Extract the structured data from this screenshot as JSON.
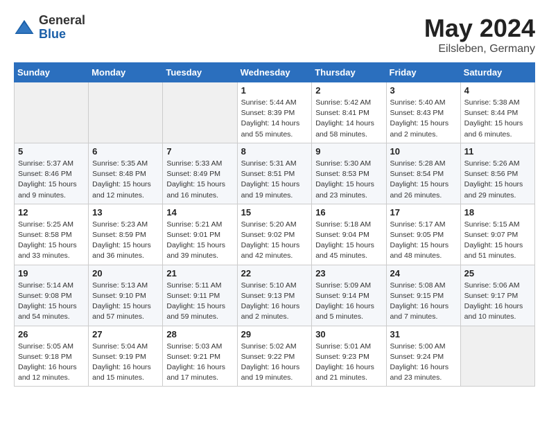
{
  "header": {
    "logo_general": "General",
    "logo_blue": "Blue",
    "title": "May 2024",
    "location": "Eilsleben, Germany"
  },
  "weekdays": [
    "Sunday",
    "Monday",
    "Tuesday",
    "Wednesday",
    "Thursday",
    "Friday",
    "Saturday"
  ],
  "weeks": [
    [
      {
        "day": "",
        "info": ""
      },
      {
        "day": "",
        "info": ""
      },
      {
        "day": "",
        "info": ""
      },
      {
        "day": "1",
        "info": "Sunrise: 5:44 AM\nSunset: 8:39 PM\nDaylight: 14 hours\nand 55 minutes."
      },
      {
        "day": "2",
        "info": "Sunrise: 5:42 AM\nSunset: 8:41 PM\nDaylight: 14 hours\nand 58 minutes."
      },
      {
        "day": "3",
        "info": "Sunrise: 5:40 AM\nSunset: 8:43 PM\nDaylight: 15 hours\nand 2 minutes."
      },
      {
        "day": "4",
        "info": "Sunrise: 5:38 AM\nSunset: 8:44 PM\nDaylight: 15 hours\nand 6 minutes."
      }
    ],
    [
      {
        "day": "5",
        "info": "Sunrise: 5:37 AM\nSunset: 8:46 PM\nDaylight: 15 hours\nand 9 minutes."
      },
      {
        "day": "6",
        "info": "Sunrise: 5:35 AM\nSunset: 8:48 PM\nDaylight: 15 hours\nand 12 minutes."
      },
      {
        "day": "7",
        "info": "Sunrise: 5:33 AM\nSunset: 8:49 PM\nDaylight: 15 hours\nand 16 minutes."
      },
      {
        "day": "8",
        "info": "Sunrise: 5:31 AM\nSunset: 8:51 PM\nDaylight: 15 hours\nand 19 minutes."
      },
      {
        "day": "9",
        "info": "Sunrise: 5:30 AM\nSunset: 8:53 PM\nDaylight: 15 hours\nand 23 minutes."
      },
      {
        "day": "10",
        "info": "Sunrise: 5:28 AM\nSunset: 8:54 PM\nDaylight: 15 hours\nand 26 minutes."
      },
      {
        "day": "11",
        "info": "Sunrise: 5:26 AM\nSunset: 8:56 PM\nDaylight: 15 hours\nand 29 minutes."
      }
    ],
    [
      {
        "day": "12",
        "info": "Sunrise: 5:25 AM\nSunset: 8:58 PM\nDaylight: 15 hours\nand 33 minutes."
      },
      {
        "day": "13",
        "info": "Sunrise: 5:23 AM\nSunset: 8:59 PM\nDaylight: 15 hours\nand 36 minutes."
      },
      {
        "day": "14",
        "info": "Sunrise: 5:21 AM\nSunset: 9:01 PM\nDaylight: 15 hours\nand 39 minutes."
      },
      {
        "day": "15",
        "info": "Sunrise: 5:20 AM\nSunset: 9:02 PM\nDaylight: 15 hours\nand 42 minutes."
      },
      {
        "day": "16",
        "info": "Sunrise: 5:18 AM\nSunset: 9:04 PM\nDaylight: 15 hours\nand 45 minutes."
      },
      {
        "day": "17",
        "info": "Sunrise: 5:17 AM\nSunset: 9:05 PM\nDaylight: 15 hours\nand 48 minutes."
      },
      {
        "day": "18",
        "info": "Sunrise: 5:15 AM\nSunset: 9:07 PM\nDaylight: 15 hours\nand 51 minutes."
      }
    ],
    [
      {
        "day": "19",
        "info": "Sunrise: 5:14 AM\nSunset: 9:08 PM\nDaylight: 15 hours\nand 54 minutes."
      },
      {
        "day": "20",
        "info": "Sunrise: 5:13 AM\nSunset: 9:10 PM\nDaylight: 15 hours\nand 57 minutes."
      },
      {
        "day": "21",
        "info": "Sunrise: 5:11 AM\nSunset: 9:11 PM\nDaylight: 15 hours\nand 59 minutes."
      },
      {
        "day": "22",
        "info": "Sunrise: 5:10 AM\nSunset: 9:13 PM\nDaylight: 16 hours\nand 2 minutes."
      },
      {
        "day": "23",
        "info": "Sunrise: 5:09 AM\nSunset: 9:14 PM\nDaylight: 16 hours\nand 5 minutes."
      },
      {
        "day": "24",
        "info": "Sunrise: 5:08 AM\nSunset: 9:15 PM\nDaylight: 16 hours\nand 7 minutes."
      },
      {
        "day": "25",
        "info": "Sunrise: 5:06 AM\nSunset: 9:17 PM\nDaylight: 16 hours\nand 10 minutes."
      }
    ],
    [
      {
        "day": "26",
        "info": "Sunrise: 5:05 AM\nSunset: 9:18 PM\nDaylight: 16 hours\nand 12 minutes."
      },
      {
        "day": "27",
        "info": "Sunrise: 5:04 AM\nSunset: 9:19 PM\nDaylight: 16 hours\nand 15 minutes."
      },
      {
        "day": "28",
        "info": "Sunrise: 5:03 AM\nSunset: 9:21 PM\nDaylight: 16 hours\nand 17 minutes."
      },
      {
        "day": "29",
        "info": "Sunrise: 5:02 AM\nSunset: 9:22 PM\nDaylight: 16 hours\nand 19 minutes."
      },
      {
        "day": "30",
        "info": "Sunrise: 5:01 AM\nSunset: 9:23 PM\nDaylight: 16 hours\nand 21 minutes."
      },
      {
        "day": "31",
        "info": "Sunrise: 5:00 AM\nSunset: 9:24 PM\nDaylight: 16 hours\nand 23 minutes."
      },
      {
        "day": "",
        "info": ""
      }
    ]
  ]
}
